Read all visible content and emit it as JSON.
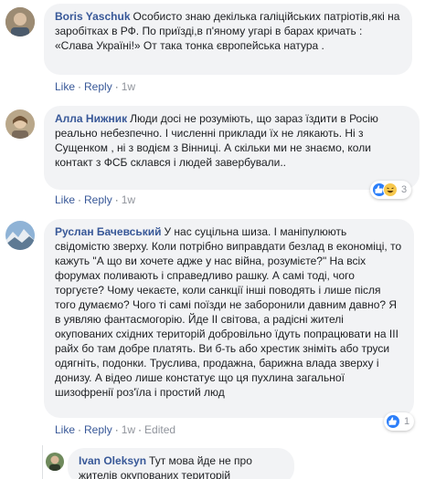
{
  "comments": [
    {
      "author": "Boris Yaschuk",
      "text": "Особисто знаю декілька галіційських патріотів,які на заробітках в РФ. По приїзді,в п'яному угарі в барах кричать : «Слава Україні!» От така тонка європейська натура .",
      "like": "Like",
      "reply": "Reply",
      "time": "1w"
    },
    {
      "author": "Алла Нижник",
      "text": "Люди досі не розуміють, що зараз їздити в Росію реально небезпечно. І численні приклади їх не лякають. Ні з Сущенком , ні з водієм з Вінниці. А скільки ми не знаємо, коли контакт з ФСБ склався і людей завербували..",
      "like": "Like",
      "reply": "Reply",
      "time": "1w",
      "reactions": {
        "count": "3",
        "types": [
          "like",
          "haha"
        ]
      }
    },
    {
      "author": "Руслан Бачевський",
      "text": "У нас суцільна шиза. І маніпулюють свідомістю зверху. Коли потрібно виправдати безлад в економіці, то кажуть \"А що ви хочете адже у нас війна, розумієте?\" На всіх форумах поливають і справедливо рашку. А самі тоді, чого торгуєте? Чому чекаєте, коли санкції інші поводять і лише після того думаємо? Чого ті самі поїзди не заборонили давним давно? Я в уявляю фантасмогорію. Йде ІІ світова, а радісні жителі окупованих східних територій добровільно їдуть попрацювати на ІІІ райх бо там добре платять. Ви б-ть або хрестик зніміть або труси одягніть, подонки. Труслива, продажна, барижна влада зверху і донизу. А відео лише констатує що ця пухлина загальної шизофренії роз'їла і простий люд",
      "like": "Like",
      "reply": "Reply",
      "time": "1w",
      "edited": "Edited",
      "reactions": {
        "count": "1",
        "types": [
          "like"
        ]
      }
    }
  ],
  "reply": {
    "author": "Ivan Oleksyn",
    "text": "Тут мова йде не про жителів окупованих територій"
  },
  "colors": {
    "link": "#385898",
    "bubble": "#f2f3f5",
    "meta": "#90949c",
    "like_reaction": "#2d7ff9",
    "haha_reaction": "#f7c84d"
  },
  "icons": {
    "like_reaction": "thumbs-up-icon",
    "haha_reaction": "laughing-face-icon"
  }
}
